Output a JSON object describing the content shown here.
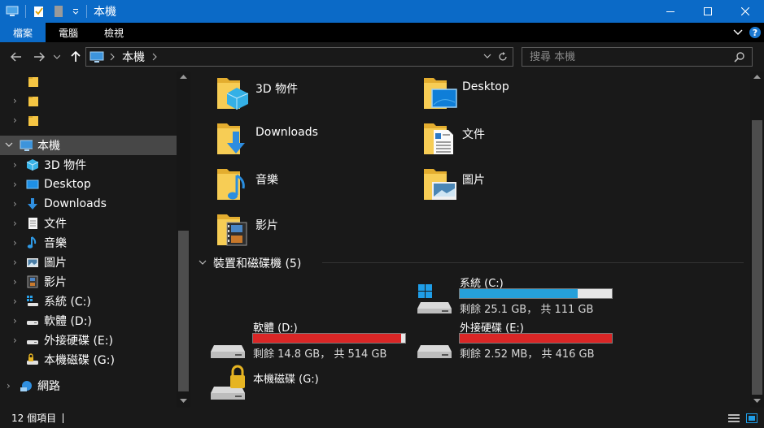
{
  "window": {
    "title": "本機"
  },
  "ribbon": {
    "tabs": [
      {
        "label": "檔案",
        "active": true
      },
      {
        "label": "電腦",
        "active": false
      },
      {
        "label": "檢視",
        "active": false
      }
    ],
    "help": "?"
  },
  "address": {
    "crumb": "本機",
    "search_placeholder": "搜尋 本機"
  },
  "nav": {
    "this_pc": "本機",
    "items": [
      {
        "label": "3D 物件",
        "icon": "3d-objects-icon"
      },
      {
        "label": "Desktop",
        "icon": "desktop-icon"
      },
      {
        "label": "Downloads",
        "icon": "downloads-icon"
      },
      {
        "label": "文件",
        "icon": "documents-icon"
      },
      {
        "label": "音樂",
        "icon": "music-icon"
      },
      {
        "label": "圖片",
        "icon": "pictures-icon"
      },
      {
        "label": "影片",
        "icon": "videos-icon"
      },
      {
        "label": "系統 (C:)",
        "icon": "system-drive-icon"
      },
      {
        "label": "軟體 (D:)",
        "icon": "drive-icon"
      },
      {
        "label": "外接硬碟 (E:)",
        "icon": "drive-icon"
      },
      {
        "label": "本機磁碟 (G:)",
        "icon": "locked-drive-icon"
      }
    ],
    "network": "網路"
  },
  "folders": [
    {
      "label": "3D 物件",
      "icon": "3d-objects-folder-icon"
    },
    {
      "label": "Desktop",
      "icon": "desktop-folder-icon"
    },
    {
      "label": "Downloads",
      "icon": "downloads-folder-icon"
    },
    {
      "label": "文件",
      "icon": "documents-folder-icon"
    },
    {
      "label": "音樂",
      "icon": "music-folder-icon"
    },
    {
      "label": "圖片",
      "icon": "pictures-folder-icon"
    },
    {
      "label": "影片",
      "icon": "videos-folder-icon"
    }
  ],
  "devices": {
    "header": "裝置和磁碟機 (5)",
    "drives": [
      {
        "name": "系統 (C:)",
        "info": "剩餘 25.1 GB， 共 111 GB",
        "used_fraction": 0.774,
        "bar_color": "#26a0da",
        "icon": "system-drive-icon"
      },
      {
        "name": "軟體 (D:)",
        "info": "剩餘 14.8 GB， 共 514 GB",
        "used_fraction": 0.971,
        "bar_color": "#da2626",
        "icon": "drive-icon"
      },
      {
        "name": "外接硬碟 (E:)",
        "info": "剩餘 2.52 MB， 共 416 GB",
        "used_fraction": 1.0,
        "bar_color": "#da2626",
        "icon": "drive-icon"
      },
      {
        "name": "本機磁碟 (G:)",
        "info": "",
        "used_fraction": null,
        "bar_color": "",
        "icon": "locked-drive-icon"
      }
    ]
  },
  "status": {
    "count": "12 個項目"
  },
  "colors": {
    "accent": "#0b6ac7",
    "bar_blue": "#26a0da",
    "bar_red": "#da2626",
    "folder": "#f5c543"
  }
}
